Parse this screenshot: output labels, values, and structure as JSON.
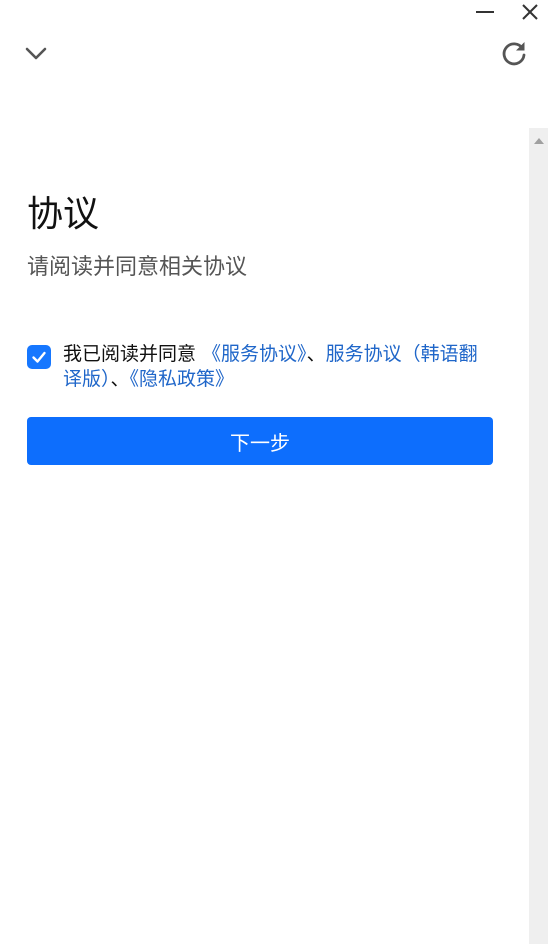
{
  "window": {
    "minimize_icon": "minimize-icon",
    "close_icon": "close-icon"
  },
  "toolbar": {
    "collapse_icon": "chevron-down-icon",
    "refresh_icon": "refresh-icon"
  },
  "page": {
    "title": "协议",
    "subtitle": "请阅读并同意相关协议"
  },
  "agreement": {
    "checked": true,
    "prefix": "我已阅读并同意 ",
    "link_service": "《服务协议》",
    "sep1": "、",
    "link_service_kr": "服务协议（韩语翻译版）",
    "sep2": "、",
    "link_privacy": "《隐私政策》"
  },
  "actions": {
    "next_label": "下一步"
  },
  "colors": {
    "accent": "#0d6efd",
    "link": "#1f66c9",
    "checkbox": "#1677ff",
    "scrollbar_track": "#efefef"
  }
}
